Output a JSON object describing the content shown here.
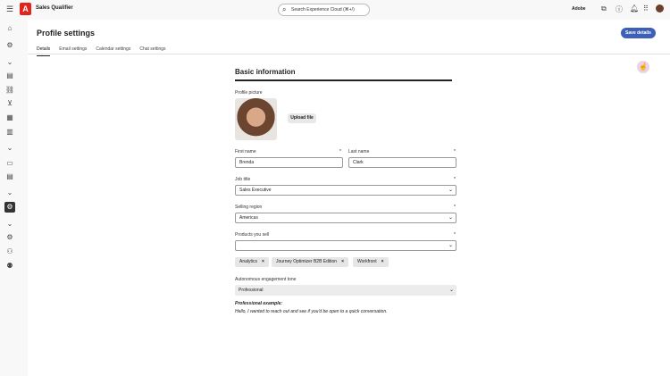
{
  "app": {
    "name": "Sales Qualifier",
    "org": "Adobe",
    "search_placeholder": "Search Experience Cloud (⌘+/)"
  },
  "page": {
    "title": "Profile settings",
    "save_label": "Save details",
    "tabs": [
      {
        "label": "Details"
      },
      {
        "label": "Email settings"
      },
      {
        "label": "Calendar settings"
      },
      {
        "label": "Chat settings"
      }
    ]
  },
  "form": {
    "heading": "Basic information",
    "profile_picture_label": "Profile picture",
    "upload_label": "Upload file",
    "first_name_label": "First name",
    "first_name": "Brenda",
    "last_name_label": "Last name",
    "last_name": "Clark",
    "job_title_label": "Job title",
    "job_title": "Sales Executive",
    "region_label": "Selling region",
    "region": "Americas",
    "products_label": "Products you sell",
    "products": [
      "Analytics",
      "Journey Optimizer B2B Edition",
      "Workfront"
    ],
    "tone_label": "Autonomous engagement tone",
    "tone": "Professional",
    "example_title": "Professional example:",
    "example_text": "Hello, I wanted to reach out and see if you'd be open to a quick conversation.",
    "required_mark": "*"
  }
}
